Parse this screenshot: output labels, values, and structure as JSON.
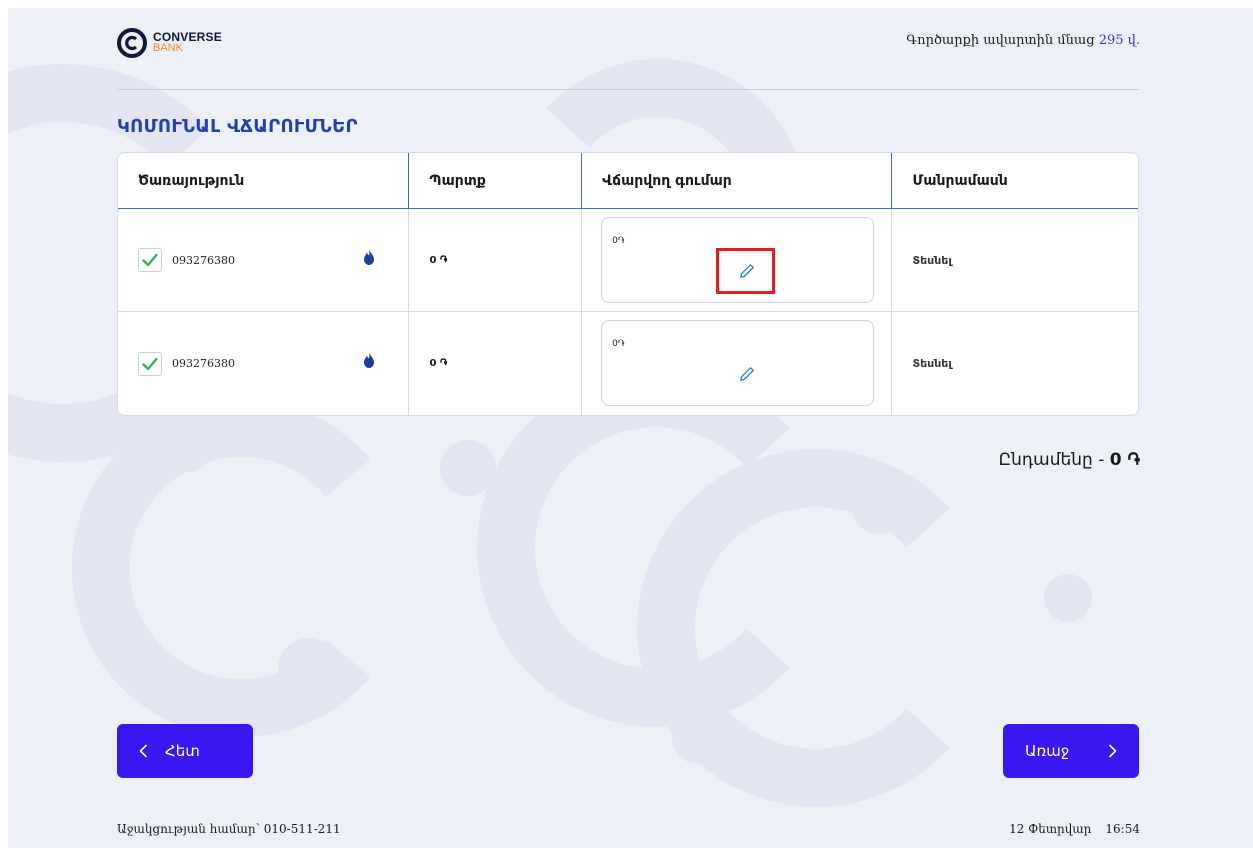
{
  "brand": {
    "name_line1": "CONVERSE",
    "name_line2": "BANK",
    "accent": "#3a16f0",
    "orange": "#f08a24"
  },
  "header": {
    "timer_text": "Գործարքի ավարտին մնաց",
    "timer_value": "295 վ."
  },
  "page": {
    "title": "ԿՈՄՈՒՆԱԼ ՎՃԱՐՈՒՄՆԵՐ"
  },
  "table": {
    "columns": [
      "Ծառայություն",
      "Պարտք",
      "Վճարվող գումար",
      "Մանրամասն"
    ],
    "rows": [
      {
        "checked": true,
        "service_number": "093276380",
        "service_icon": "gas-flame-icon",
        "debt": "0 ֏",
        "amount": "0֏",
        "details": "Տեսնել"
      },
      {
        "checked": true,
        "service_number": "093276380",
        "service_icon": "gas-flame-icon",
        "debt": "0 ֏",
        "amount": "0֏",
        "details": "Տեսնել"
      }
    ]
  },
  "total": {
    "label": "Ընդամենը -",
    "value": "0 ֏"
  },
  "buttons": {
    "back_label": "Հետ",
    "next_label": "Առաջ"
  },
  "footer": {
    "support_label": "Աջակցության համար՝",
    "support_phone": "010-511-211",
    "date": "12 Փետրվար",
    "time": "16:54"
  }
}
